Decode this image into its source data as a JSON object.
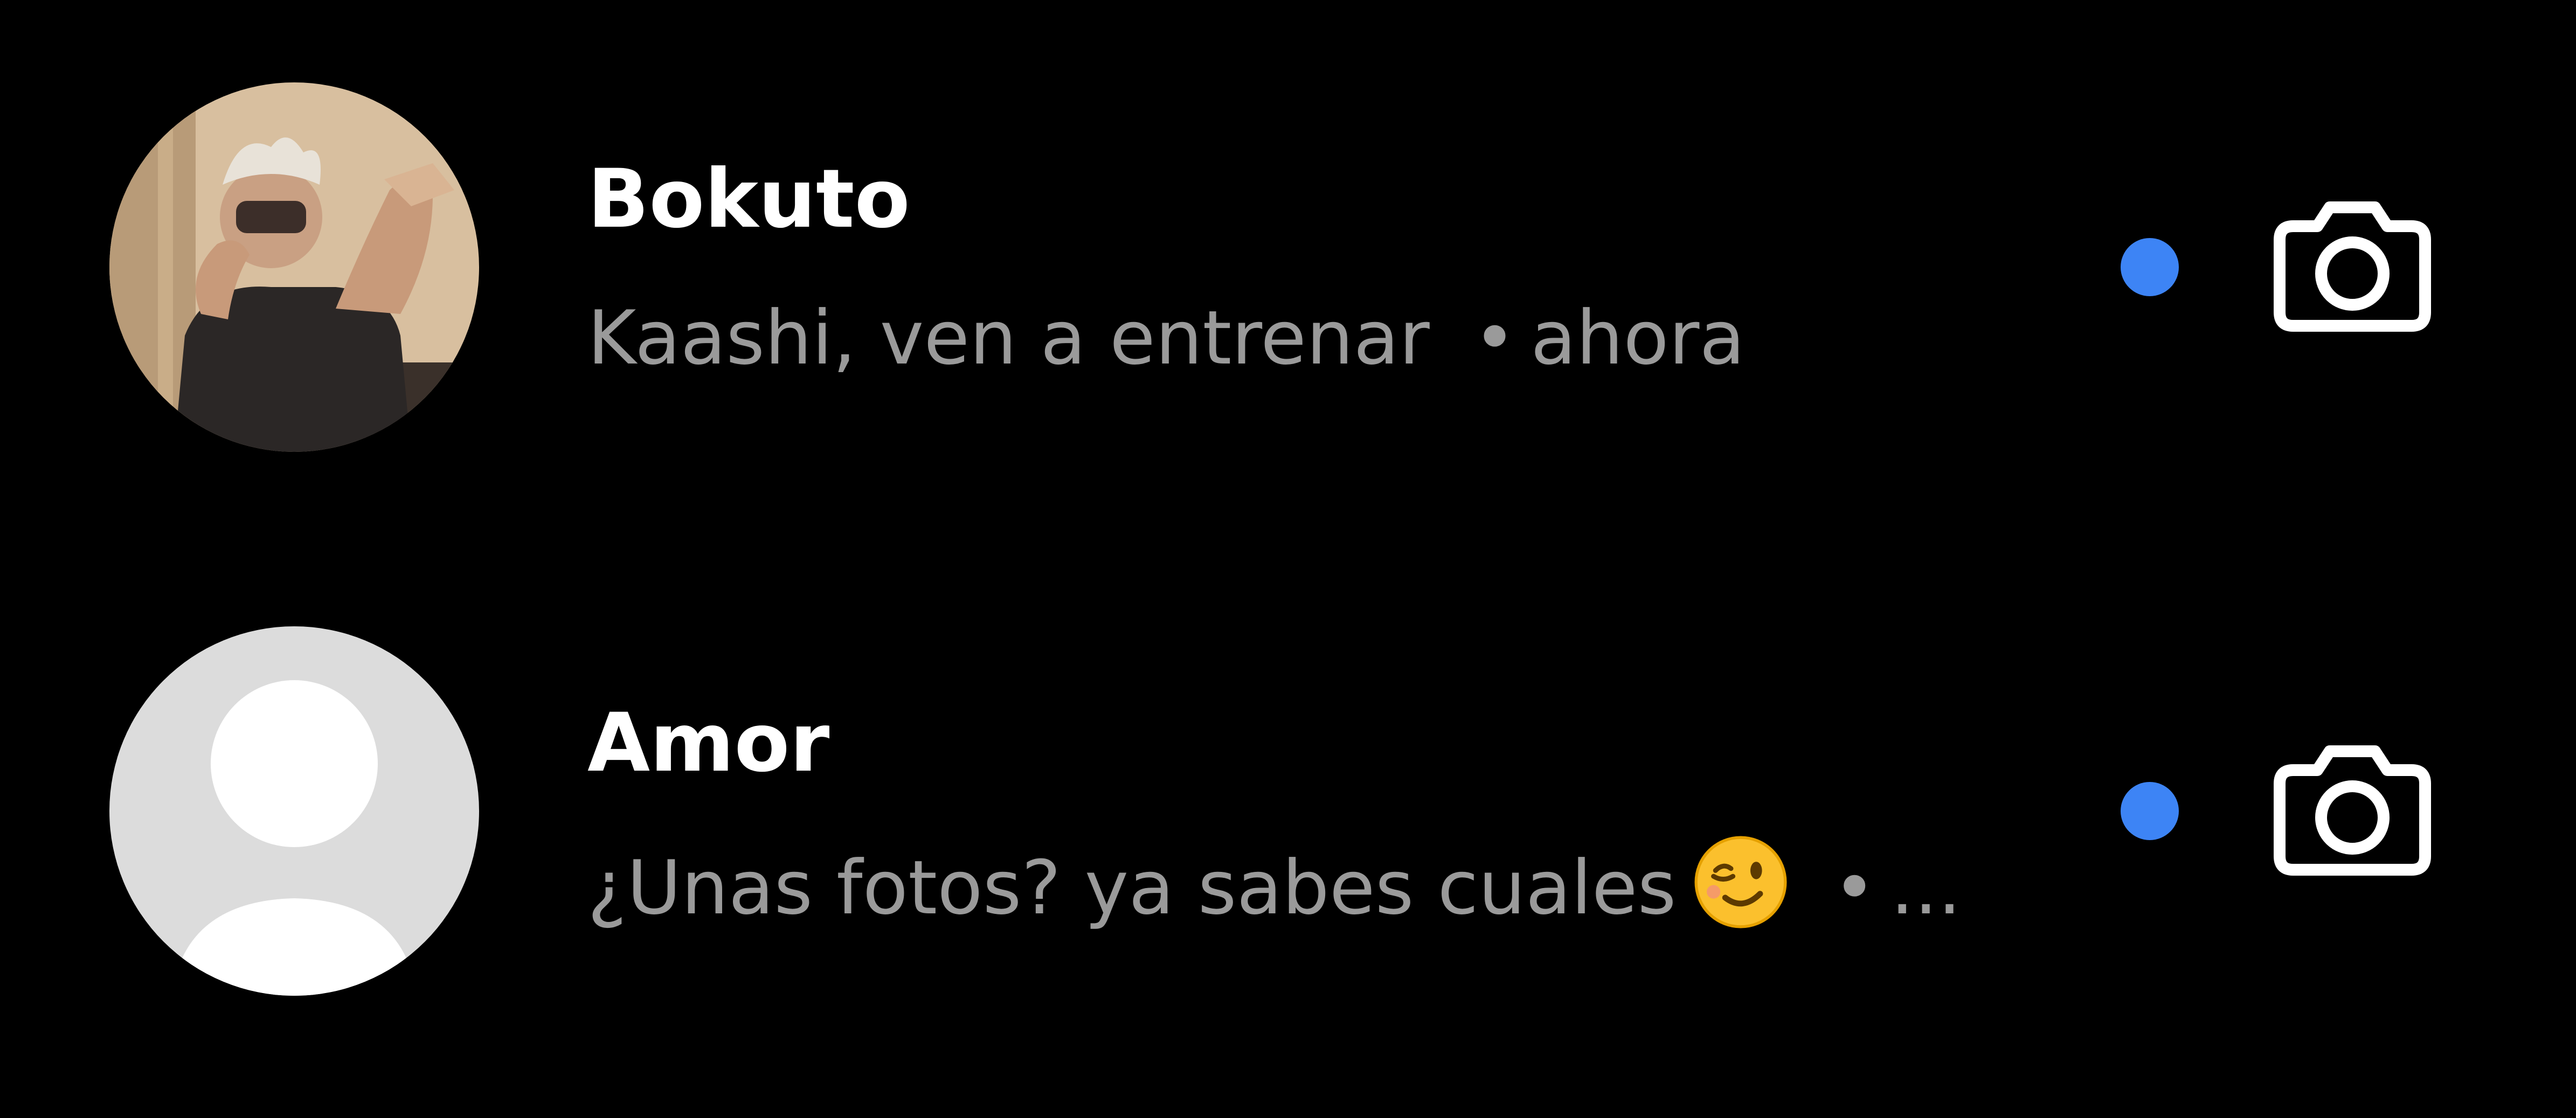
{
  "threads": [
    {
      "name": "Bokuto",
      "preview": "Kaashi, ven a entrenar",
      "separator": "•",
      "time": "ahora",
      "avatar": "user-photo",
      "unread": true,
      "camera_icon": "camera-icon"
    },
    {
      "name": "Amor",
      "preview": "¿Unas fotos? ya sabes cuales",
      "emoji": "winking-face-emoji",
      "separator": "•",
      "time": "...",
      "avatar": "default-profile-placeholder",
      "unread": true,
      "camera_icon": "camera-icon"
    }
  ],
  "colors": {
    "background": "#000000",
    "name_text": "#ffffff",
    "preview_text": "#9a9a9a",
    "unread_dot": "#3d84f5",
    "placeholder_avatar_bg": "#dcdcdc",
    "icon": "#ffffff"
  }
}
